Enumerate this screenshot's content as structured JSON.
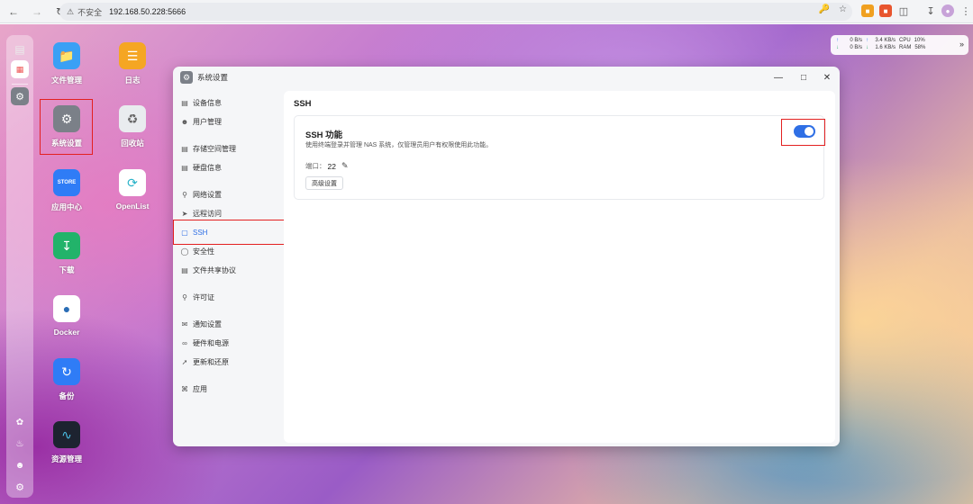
{
  "browser": {
    "security_label": "不安全",
    "url": "192.168.50.228:5666"
  },
  "desktop_icons": [
    {
      "label": "文件管理",
      "icon": "folder-icon",
      "color": "#3aa0f5"
    },
    {
      "label": "日志",
      "icon": "log-icon",
      "color": "#f5a623"
    },
    {
      "label": "系统设置",
      "icon": "gear-icon",
      "color": "#7b8088"
    },
    {
      "label": "回收站",
      "icon": "recycle-bin-icon",
      "color": "#e9ecef"
    },
    {
      "label": "应用中心",
      "icon": "store-icon",
      "color": "#2f7cf6",
      "tile_text": "STORE"
    },
    {
      "label": "OpenList",
      "icon": "openlist-icon",
      "color": "#ffffff"
    },
    {
      "label": "下载",
      "icon": "download-icon",
      "color": "#22b36a"
    },
    {
      "label": "Docker",
      "icon": "docker-icon",
      "color": "#ffffff"
    },
    {
      "label": "备份",
      "icon": "backup-icon",
      "color": "#2f7cf6"
    },
    {
      "label": "资源管理",
      "icon": "resource-monitor-icon",
      "color": "#1d2330"
    }
  ],
  "net_widget": {
    "up_speed": "0 B/s",
    "down_speed": "0 B/s",
    "up_total": "3.4 KB/s",
    "down_total": "1.6 KB/s",
    "cpu_label": "CPU",
    "cpu_value": "10%",
    "ram_label": "RAM",
    "ram_value": "58%"
  },
  "window": {
    "title": "系统设置",
    "sidebar": [
      {
        "label": "设备信息",
        "icon": "device-icon"
      },
      {
        "label": "用户管理",
        "icon": "user-icon"
      },
      {
        "label": "存储空间管理",
        "icon": "storage-icon"
      },
      {
        "label": "硬盘信息",
        "icon": "disk-icon"
      },
      {
        "label": "网络设置",
        "icon": "network-icon"
      },
      {
        "label": "远程访问",
        "icon": "send-icon"
      },
      {
        "label": "SSH",
        "icon": "terminal-icon",
        "active": true
      },
      {
        "label": "安全性",
        "icon": "shield-icon"
      },
      {
        "label": "文件共享协议",
        "icon": "file-icon"
      },
      {
        "label": "许可证",
        "icon": "key-icon"
      },
      {
        "label": "通知设置",
        "icon": "mail-icon"
      },
      {
        "label": "硬件和电源",
        "icon": "power-icon"
      },
      {
        "label": "更新和还原",
        "icon": "rocket-icon"
      },
      {
        "label": "应用",
        "icon": "apps-icon"
      }
    ],
    "page_title": "SSH",
    "ssh": {
      "title": "SSH 功能",
      "description": "使用终端登录并管理 NAS 系统，仅管理员用户有权限使用此功能。",
      "port_label": "端口：",
      "port_value": "22",
      "advanced_button": "高级设置",
      "enabled": true
    }
  }
}
